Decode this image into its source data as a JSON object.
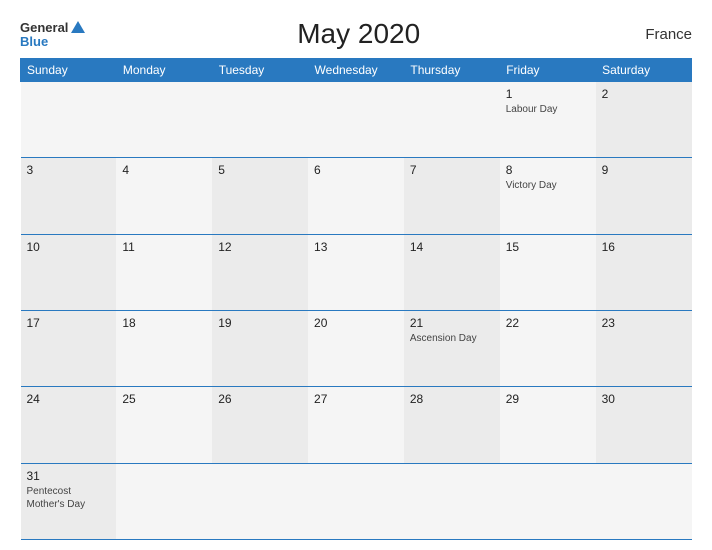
{
  "header": {
    "logo_general": "General",
    "logo_blue": "Blue",
    "title": "May 2020",
    "country": "France"
  },
  "days_of_week": [
    "Sunday",
    "Monday",
    "Tuesday",
    "Wednesday",
    "Thursday",
    "Friday",
    "Saturday"
  ],
  "weeks": [
    [
      {
        "day": "",
        "event": ""
      },
      {
        "day": "",
        "event": ""
      },
      {
        "day": "",
        "event": ""
      },
      {
        "day": "",
        "event": ""
      },
      {
        "day": "",
        "event": ""
      },
      {
        "day": "1",
        "event": "Labour Day"
      },
      {
        "day": "2",
        "event": ""
      }
    ],
    [
      {
        "day": "3",
        "event": ""
      },
      {
        "day": "4",
        "event": ""
      },
      {
        "day": "5",
        "event": ""
      },
      {
        "day": "6",
        "event": ""
      },
      {
        "day": "7",
        "event": ""
      },
      {
        "day": "8",
        "event": "Victory Day"
      },
      {
        "day": "9",
        "event": ""
      }
    ],
    [
      {
        "day": "10",
        "event": ""
      },
      {
        "day": "11",
        "event": ""
      },
      {
        "day": "12",
        "event": ""
      },
      {
        "day": "13",
        "event": ""
      },
      {
        "day": "14",
        "event": ""
      },
      {
        "day": "15",
        "event": ""
      },
      {
        "day": "16",
        "event": ""
      }
    ],
    [
      {
        "day": "17",
        "event": ""
      },
      {
        "day": "18",
        "event": ""
      },
      {
        "day": "19",
        "event": ""
      },
      {
        "day": "20",
        "event": ""
      },
      {
        "day": "21",
        "event": "Ascension Day"
      },
      {
        "day": "22",
        "event": ""
      },
      {
        "day": "23",
        "event": ""
      }
    ],
    [
      {
        "day": "24",
        "event": ""
      },
      {
        "day": "25",
        "event": ""
      },
      {
        "day": "26",
        "event": ""
      },
      {
        "day": "27",
        "event": ""
      },
      {
        "day": "28",
        "event": ""
      },
      {
        "day": "29",
        "event": ""
      },
      {
        "day": "30",
        "event": ""
      }
    ],
    [
      {
        "day": "31",
        "event": "Pentecost\nMother's Day"
      },
      {
        "day": "",
        "event": ""
      },
      {
        "day": "",
        "event": ""
      },
      {
        "day": "",
        "event": ""
      },
      {
        "day": "",
        "event": ""
      },
      {
        "day": "",
        "event": ""
      },
      {
        "day": "",
        "event": ""
      }
    ]
  ]
}
